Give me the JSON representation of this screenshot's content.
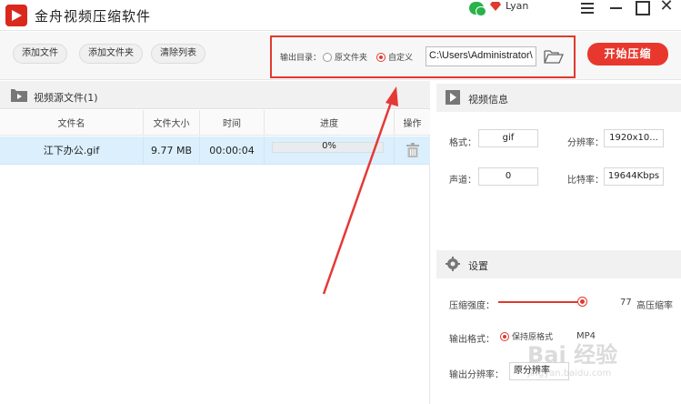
{
  "app": {
    "title": "金舟视频压缩软件",
    "user": "Lyan"
  },
  "toolbar": {
    "add_file": "添加文件",
    "add_folder": "添加文件夹",
    "clear_list": "清除列表",
    "output_label": "输出目录：",
    "option_original": "原文件夹",
    "option_custom": "自定义",
    "output_path": "C:\\Users\\Administrator\\",
    "start": "开始压缩"
  },
  "file_panel": {
    "title": "视频源文件(1)",
    "columns": [
      "文件名",
      "文件大小",
      "时间",
      "进度",
      "操作"
    ],
    "rows": [
      {
        "name": "江下办公.gif",
        "size": "9.77 MB",
        "time": "00:00:04",
        "progress": 0,
        "progress_text": "0%"
      }
    ]
  },
  "video_info": {
    "title": "视频信息",
    "format_label": "格式：",
    "format_value": "gif",
    "resolution_label": "分辨率：",
    "resolution_value": "1920x10...",
    "channel_label": "声道：",
    "channel_value": "0",
    "bitrate_label": "比特率：",
    "bitrate_value": "19644Kbps"
  },
  "settings": {
    "title": "设置",
    "strength_label": "压缩强度：",
    "strength_value": "77",
    "strength_tag": "高压缩率",
    "format_label": "输出格式：",
    "format_option": "保持原格式",
    "format_option2": "MP4",
    "resolution_label": "输出分辨率：",
    "resolution_option": "原分辨率"
  },
  "watermark": {
    "text": "Bai 经验",
    "url": "jingyan.baidu.com"
  },
  "colors": {
    "accent": "#e8382d",
    "selected_row": "#dbeffd",
    "header_bg": "#f1f1f1"
  }
}
